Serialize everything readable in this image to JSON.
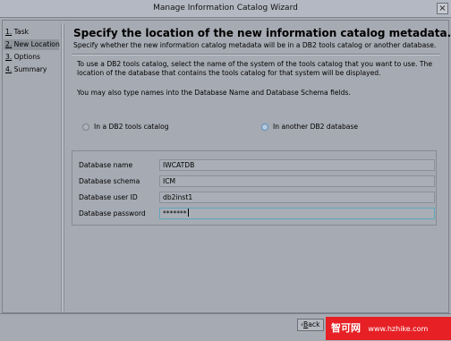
{
  "window": {
    "title": "Manage Information Catalog Wizard",
    "close_glyph": "×"
  },
  "sidebar": {
    "items": [
      {
        "num": "1.",
        "label": "Task",
        "selected": false
      },
      {
        "num": "2.",
        "label": "New Location",
        "selected": true
      },
      {
        "num": "3.",
        "label": "Options",
        "selected": false
      },
      {
        "num": "4.",
        "label": "Summary",
        "selected": false
      }
    ]
  },
  "page": {
    "heading": "Specify the location of the new information catalog metadata.",
    "subheading": "Specify whether the new information catalog metadata will be in a DB2 tools catalog or another database.",
    "instruction_line1": "To use a DB2 tools catalog, select the name of the system of the tools catalog that you want to use.  The",
    "instruction_line2": "location of the database that contains the tools catalog for that system will be displayed.",
    "instruction_line3": "You may also type names into the Database Name and Database Schema fields."
  },
  "options": {
    "tools_catalog": {
      "label": "In a DB2 tools catalog",
      "selected": false
    },
    "another_db": {
      "label": "In another DB2 database",
      "selected": true
    }
  },
  "fields": [
    {
      "label": "Database name",
      "value": "IWCATDB"
    },
    {
      "label": "Database schema",
      "value": "ICM"
    },
    {
      "label": "Database user ID",
      "value": "db2inst1"
    },
    {
      "label": "Database password",
      "value": "*******"
    }
  ],
  "buttons": {
    "back_mnemonic": "B",
    "back_rest": "ack"
  },
  "watermark": {
    "site_cn": "智可网",
    "url": "www.hzhike.com"
  },
  "colors": {
    "selection": "#8e939c",
    "focus": "#5fa7c0",
    "radio_on": "#5a8fc0",
    "watermark_bg": "#e62025"
  }
}
